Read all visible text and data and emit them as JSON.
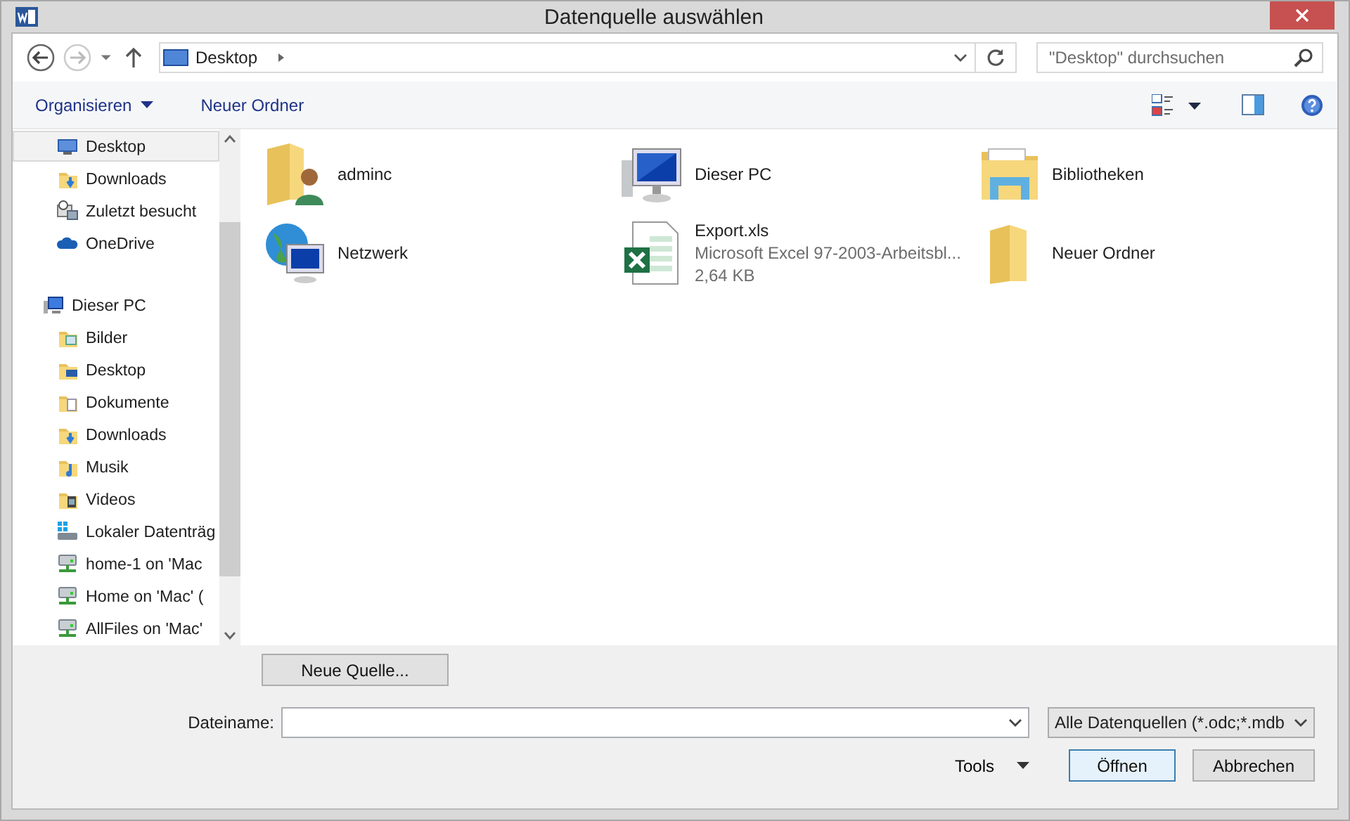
{
  "window": {
    "title": "Datenquelle auswählen"
  },
  "address_bar": {
    "location": "Desktop"
  },
  "search": {
    "placeholder": "\"Desktop\" durchsuchen"
  },
  "toolbar": {
    "organize": "Organisieren",
    "new_folder": "Neuer Ordner"
  },
  "sidebar": {
    "items": [
      {
        "label": "Desktop",
        "kind": "desktop",
        "selected": true
      },
      {
        "label": "Downloads",
        "kind": "downloads",
        "selected": false
      },
      {
        "label": "Zuletzt besucht",
        "kind": "recent",
        "selected": false
      },
      {
        "label": "OneDrive",
        "kind": "cloud",
        "selected": false
      },
      {
        "label": "Dieser PC",
        "kind": "pc",
        "selected": false,
        "children": [
          {
            "label": "Bilder",
            "kind": "pictures",
            "selected": false
          },
          {
            "label": "Desktop",
            "kind": "desktop-folder",
            "selected": false
          },
          {
            "label": "Dokumente",
            "kind": "documents",
            "selected": false
          },
          {
            "label": "Downloads",
            "kind": "downloads",
            "selected": false
          },
          {
            "label": "Musik",
            "kind": "music",
            "selected": false
          },
          {
            "label": "Videos",
            "kind": "videos",
            "selected": false
          },
          {
            "label": "Lokaler Datenträg",
            "kind": "drive",
            "selected": false
          },
          {
            "label": "home-1 on 'Mac",
            "kind": "network-drive",
            "selected": false
          },
          {
            "label": "Home on 'Mac' (",
            "kind": "network-drive",
            "selected": false
          },
          {
            "label": "AllFiles on 'Mac'",
            "kind": "network-drive",
            "selected": false
          }
        ]
      }
    ]
  },
  "files": [
    {
      "name": "adminc",
      "kind": "user-folder"
    },
    {
      "name": "Dieser PC",
      "kind": "pc"
    },
    {
      "name": "Bibliotheken",
      "kind": "library"
    },
    {
      "name": "Netzwerk",
      "kind": "network"
    },
    {
      "name": "Export.xls",
      "kind": "excel",
      "type": "Microsoft Excel 97-2003-Arbeitsbl...",
      "size": "2,64 KB"
    },
    {
      "name": "Neuer Ordner",
      "kind": "folder"
    }
  ],
  "new_source_button": "Neue Quelle...",
  "filename": {
    "label": "Dateiname:"
  },
  "filter": "Alle Datenquellen (*.odc;*.mdb",
  "tools": "Tools",
  "buttons": [
    "Öffnen",
    "Abbrechen"
  ]
}
